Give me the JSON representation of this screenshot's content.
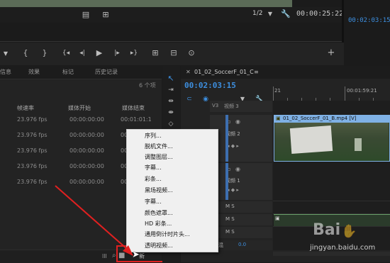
{
  "program_monitor": {
    "page_select": "1/2",
    "timecode": "00:00:25:22",
    "right_timecode": "00:02:03:15"
  },
  "transport": {
    "marker": "▼",
    "in_brace": "{",
    "out_brace": "}",
    "go_in": "{◂",
    "step_back": "◂|",
    "play": "▶",
    "step_fwd": "|▸",
    "go_out": "▸}",
    "insert": "⊞",
    "overwrite": "⊟",
    "camera": "⊙",
    "add": "+"
  },
  "project_panel": {
    "tabs": [
      "信息",
      "效果",
      "标记",
      "历史记录"
    ],
    "item_count": "6 个项",
    "columns": [
      "帧速率",
      "媒体开始",
      "媒体结束"
    ],
    "rows": [
      {
        "fps": "23.976 fps",
        "start": "00:00:00:00",
        "end": "00:01:01:1"
      },
      {
        "fps": "23.976 fps",
        "start": "00:00:00:00",
        "end": "00:00:0"
      },
      {
        "fps": "23.976 fps",
        "start": "00:00:00:00",
        "end": "00:00:0"
      },
      {
        "fps": "23.976 fps",
        "start": "00:00:00:00",
        "end": "00:00:0"
      },
      {
        "fps": "23.976 fps",
        "start": "00:00:00:00",
        "end": "00:00:0"
      }
    ],
    "bottom_icons": [
      "lll",
      "⌕",
      "■",
      "新"
    ]
  },
  "context_menu": {
    "items": [
      "序列...",
      "脱机文件...",
      "调整图层...",
      "字幕...",
      "彩条...",
      "黑场视频...",
      "字幕...",
      "颜色遮罩...",
      "HD 彩条...",
      "通用倒计时片头...",
      "透明视频..."
    ]
  },
  "timeline": {
    "sequence_name": "01_02_SoccerF_01_C",
    "menu_glyph": "≡",
    "timecode": "00:02:03:15",
    "ruler_labels": [
      "21",
      "00:01:59:21"
    ],
    "tracks": [
      {
        "id": "V3",
        "name": "视频 3"
      },
      {
        "id": "",
        "name": "视频 2"
      },
      {
        "id": "",
        "name": "视频 1"
      },
      {
        "id": "",
        "name": "M S"
      },
      {
        "id": "",
        "name": "M S"
      },
      {
        "id": "",
        "name": "M S"
      }
    ],
    "clip_label": "01_02_SoccerF_01_B.mp4 [V]",
    "level_value": "0.0",
    "level_label": "混"
  },
  "watermark": "jingyan.baidu.com",
  "colors": {
    "accent_blue": "#3d8fe0",
    "clip_blue": "#7fb1e5",
    "highlight_red": "#e02020"
  }
}
